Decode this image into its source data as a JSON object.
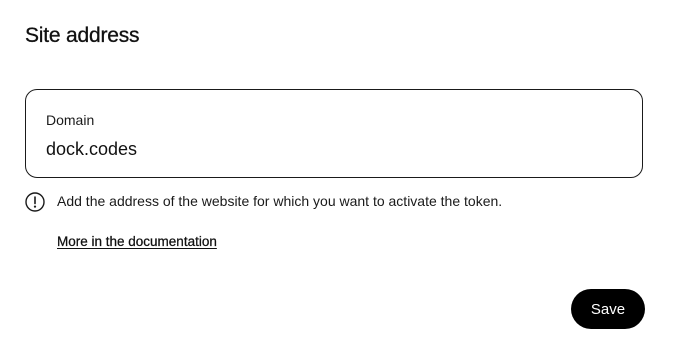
{
  "page": {
    "title": "Site address"
  },
  "domain_field": {
    "label": "Domain",
    "value": "dock.codes"
  },
  "hint": {
    "icon": "info-circle-icon",
    "text": "Add the address of the website for which you want to activate the token."
  },
  "documentation_link": {
    "label": "More in the documentation"
  },
  "actions": {
    "save_label": "Save"
  },
  "colors": {
    "primary": "#000000",
    "on_primary": "#ffffff",
    "text": "#111111",
    "border": "#1a1a1a",
    "background": "#ffffff"
  }
}
